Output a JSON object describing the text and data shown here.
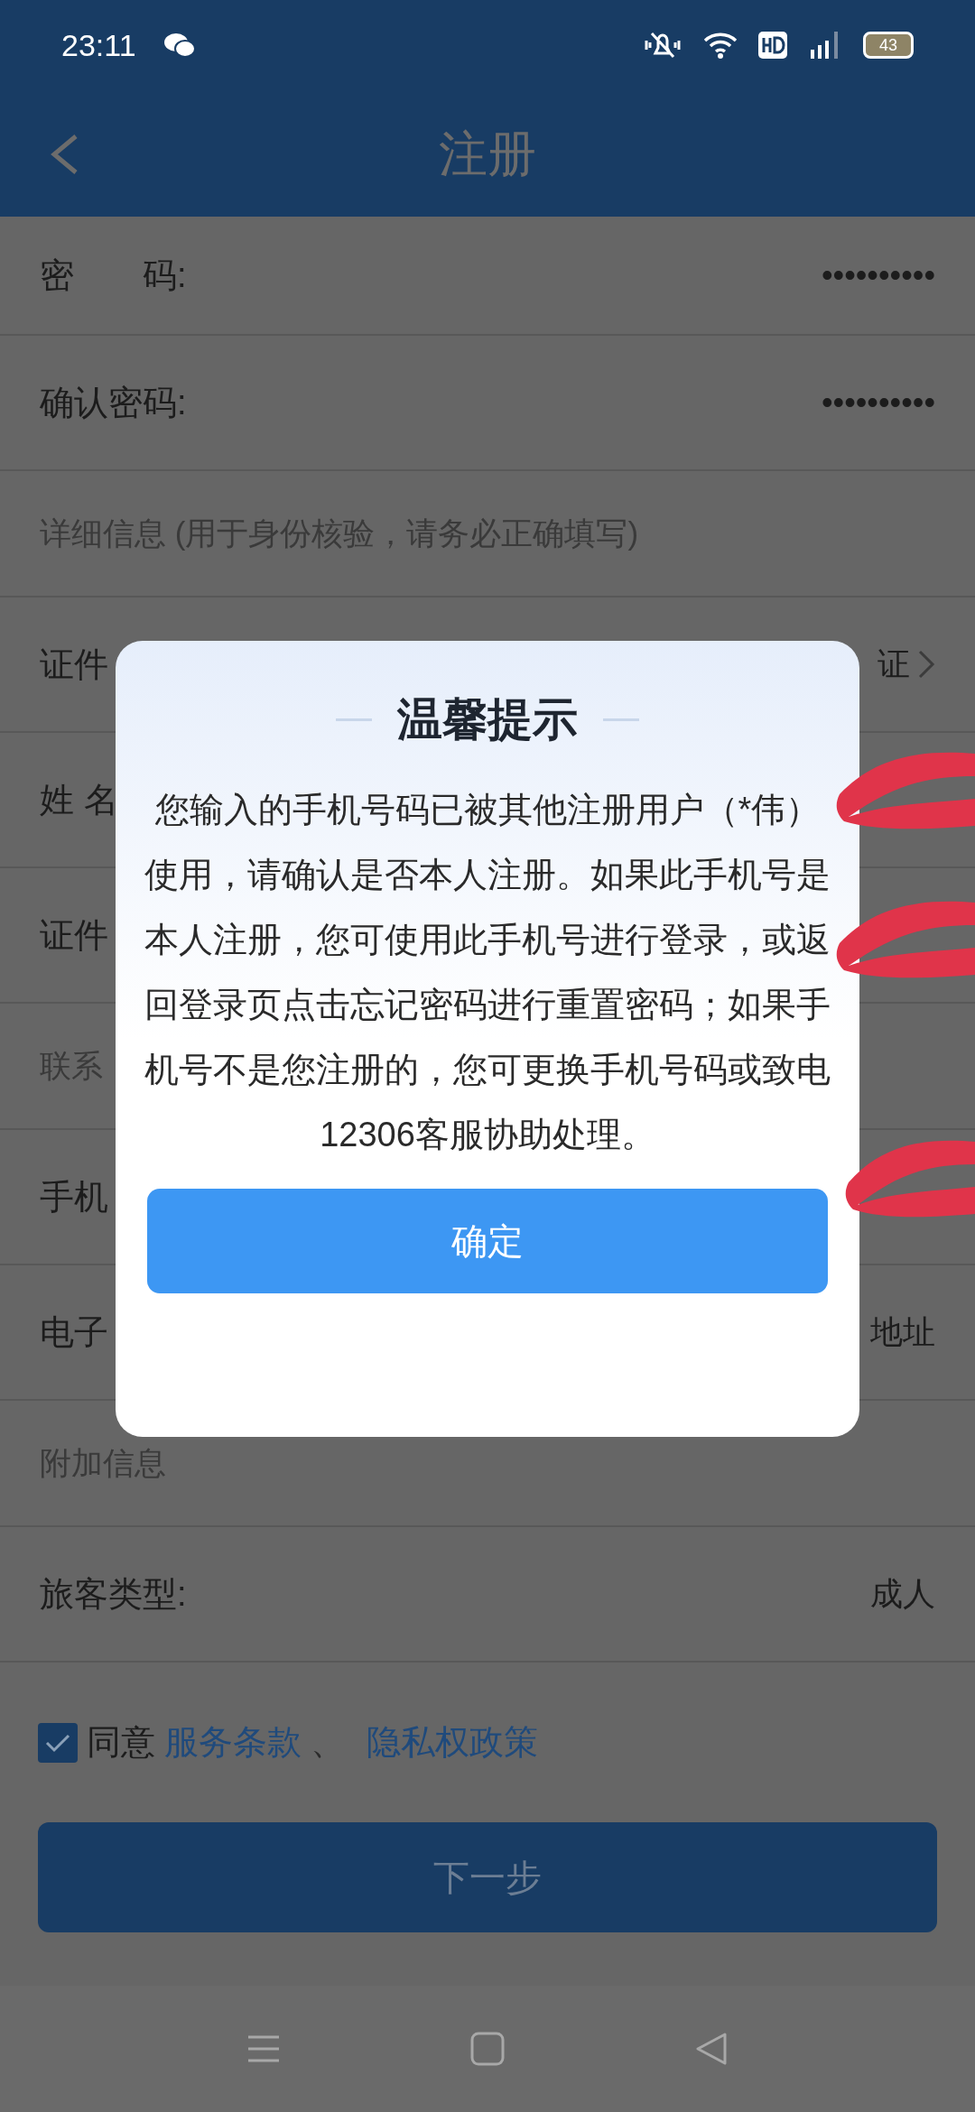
{
  "status_bar": {
    "time": "23:11",
    "battery": "43"
  },
  "header": {
    "title": "注册"
  },
  "form_rows": [
    {
      "kind": "field",
      "label": "密　　码:",
      "value": "••••••••••"
    },
    {
      "kind": "field",
      "label": "确认密码:",
      "value": "••••••••••"
    },
    {
      "kind": "section",
      "label": "详细信息 (用于身份核验，请务必正确填写)"
    },
    {
      "kind": "field",
      "label": "证件",
      "value": "证",
      "chevron": true
    },
    {
      "kind": "field",
      "label": "姓 名"
    },
    {
      "kind": "field",
      "label": "证件"
    },
    {
      "kind": "section",
      "label": "联系"
    },
    {
      "kind": "field",
      "label": "手机"
    },
    {
      "kind": "field",
      "label": "电子",
      "value": "地址"
    },
    {
      "kind": "section",
      "label": "附加信息"
    },
    {
      "kind": "field",
      "label": "旅客类型:",
      "value": "成人"
    }
  ],
  "agreement": {
    "checked": true,
    "prefix": "同意",
    "links": [
      "服务条款",
      "隐私权政策"
    ],
    "separator": "、"
  },
  "next_button": {
    "label": "下一步"
  },
  "dialog": {
    "title": "温馨提示",
    "message": "您输入的手机号码已被其他注册用户（*伟）使用，请确认是否本人注册。如果此手机号是本人注册，您可使用此手机号进行登录，或返回登录页点击忘记密码进行重置密码；如果手机号不是您注册的，您可更换手机号码或致电12306客服协助处理。",
    "button": "确定"
  }
}
